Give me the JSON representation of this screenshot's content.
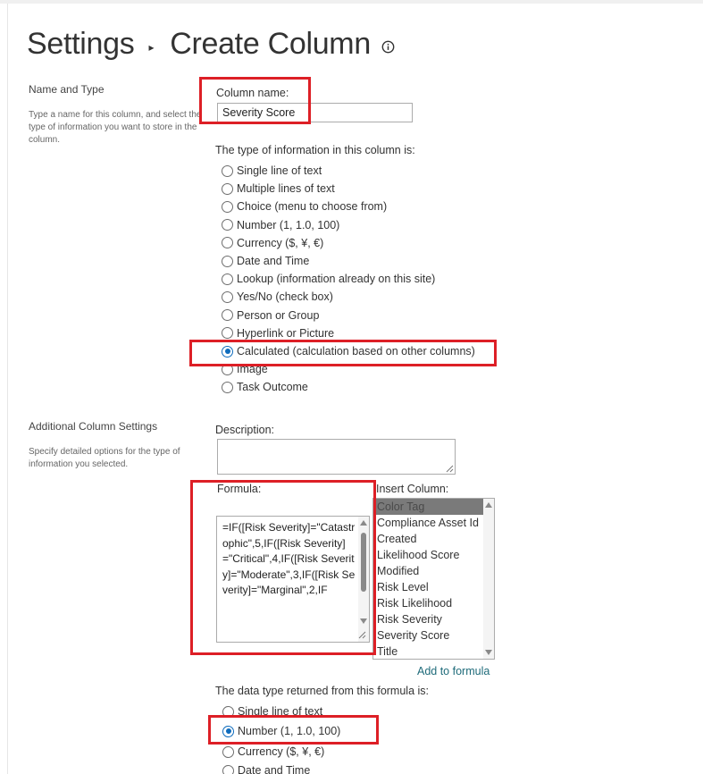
{
  "breadcrumb": {
    "parent": "Settings",
    "current": "Create Column",
    "separator_icon": "caret-right-icon",
    "info_icon": "info-icon"
  },
  "name_and_type": {
    "title": "Name and Type",
    "description": "Type a name for this column, and select the type of information you want to store in the column.",
    "column_name_label": "Column name:",
    "column_name_value": "Severity Score",
    "type_label": "The type of information in this column is:",
    "types": [
      {
        "label": "Single line of text",
        "checked": false
      },
      {
        "label": "Multiple lines of text",
        "checked": false
      },
      {
        "label": "Choice (menu to choose from)",
        "checked": false
      },
      {
        "label": "Number (1, 1.0, 100)",
        "checked": false
      },
      {
        "label": "Currency ($, ¥, €)",
        "checked": false
      },
      {
        "label": "Date and Time",
        "checked": false
      },
      {
        "label": "Lookup (information already on this site)",
        "checked": false
      },
      {
        "label": "Yes/No (check box)",
        "checked": false
      },
      {
        "label": "Person or Group",
        "checked": false
      },
      {
        "label": "Hyperlink or Picture",
        "checked": false
      },
      {
        "label": "Calculated (calculation based on other columns)",
        "checked": true
      },
      {
        "label": "Image",
        "checked": false
      },
      {
        "label": "Task Outcome",
        "checked": false
      }
    ]
  },
  "additional_settings": {
    "title": "Additional Column Settings",
    "description": "Specify detailed options for the type of information you selected.",
    "description_label": "Description:",
    "description_value": "",
    "formula_label": "Formula:",
    "formula_value": "=IF([Risk Severity]=\"Catastrophic\",5,IF([Risk Severity]=\"Critical\",4,IF([Risk Severity]=\"Moderate\",3,IF([Risk Severity]=\"Marginal\",2,IF",
    "insert_column_label": "Insert Column:",
    "insert_columns": [
      {
        "label": "Color Tag",
        "selected": true
      },
      {
        "label": "Compliance Asset Id",
        "selected": false
      },
      {
        "label": "Created",
        "selected": false
      },
      {
        "label": "Likelihood Score",
        "selected": false
      },
      {
        "label": "Modified",
        "selected": false
      },
      {
        "label": "Risk Level",
        "selected": false
      },
      {
        "label": "Risk Likelihood",
        "selected": false
      },
      {
        "label": "Risk Severity",
        "selected": false
      },
      {
        "label": "Severity Score",
        "selected": false
      },
      {
        "label": "Title",
        "selected": false
      }
    ],
    "add_to_formula": "Add to formula",
    "return_type_label": "The data type returned from this formula is:",
    "return_types": [
      {
        "label": "Single line of text",
        "checked": false
      },
      {
        "label": "Number (1, 1.0, 100)",
        "checked": true
      },
      {
        "label": "Currency ($, ¥, €)",
        "checked": false
      },
      {
        "label": "Date and Time",
        "checked": false
      }
    ]
  },
  "colors": {
    "highlight": "#dd1f26",
    "radio_checked": "#0f6cbd",
    "link": "#1f6b7a",
    "list_selected_bg": "#7a7a7a"
  }
}
